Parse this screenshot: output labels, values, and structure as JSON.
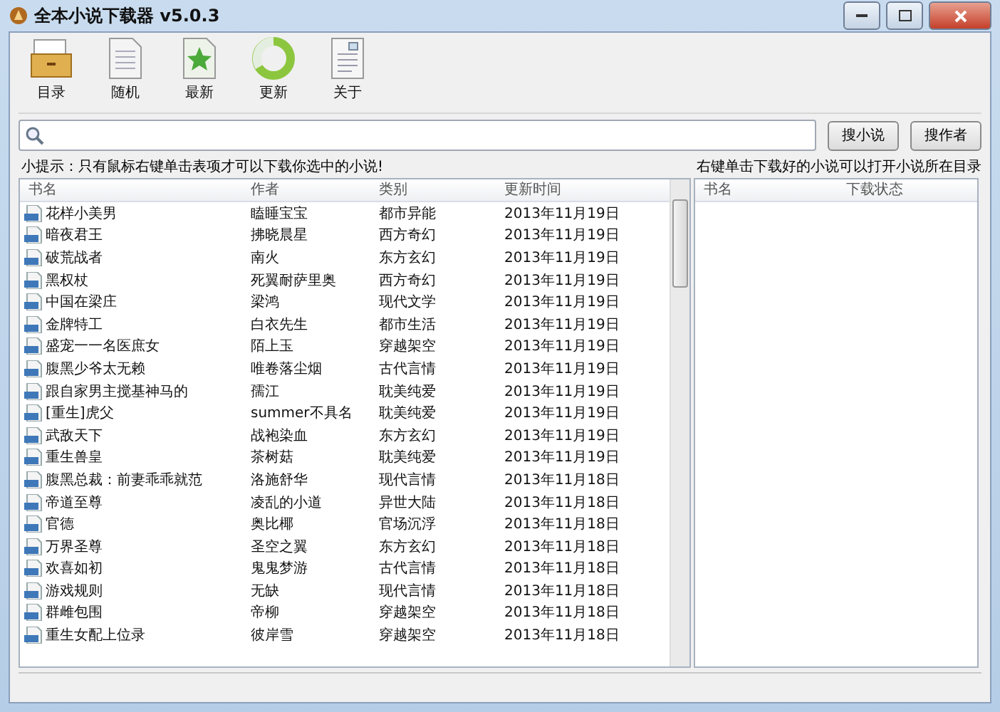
{
  "window": {
    "title": "全本小说下载器 v5.0.3"
  },
  "toolbar": [
    {
      "label": "目录",
      "kind": "folder"
    },
    {
      "label": "随机",
      "kind": "document"
    },
    {
      "label": "最新",
      "kind": "star"
    },
    {
      "label": "更新",
      "kind": "ring"
    },
    {
      "label": "关于",
      "kind": "about"
    }
  ],
  "search": {
    "buttons": [
      "搜小说",
      "搜作者"
    ]
  },
  "left_panel": {
    "hint": "小提示：只有鼠标右键单击表项才可以下载你选中的小说!",
    "columns": [
      "书名",
      "作者",
      "类别",
      "更新时间"
    ],
    "rows": [
      [
        "花样小美男",
        "瞌睡宝宝",
        "都市异能",
        "2013年11月19日"
      ],
      [
        "暗夜君王",
        "拂晓晨星",
        "西方奇幻",
        "2013年11月19日"
      ],
      [
        "破荒战者",
        "南火",
        "东方玄幻",
        "2013年11月19日"
      ],
      [
        "黑权杖",
        "死翼耐萨里奥",
        "西方奇幻",
        "2013年11月19日"
      ],
      [
        "中国在梁庄",
        "梁鸿",
        "现代文学",
        "2013年11月19日"
      ],
      [
        "金牌特工",
        "白衣先生",
        "都市生活",
        "2013年11月19日"
      ],
      [
        "盛宠一一名医庶女",
        "陌上玉",
        "穿越架空",
        "2013年11月19日"
      ],
      [
        "腹黑少爷太无赖",
        "唯卷落尘烟",
        "古代言情",
        "2013年11月19日"
      ],
      [
        "跟自家男主搅基神马的",
        "孺江",
        "耽美纯爱",
        "2013年11月19日"
      ],
      [
        "[重生]虎父",
        "summer不具名",
        "耽美纯爱",
        "2013年11月19日"
      ],
      [
        "武敌天下",
        "战袍染血",
        "东方玄幻",
        "2013年11月19日"
      ],
      [
        "重生兽皇",
        "茶树菇",
        "耽美纯爱",
        "2013年11月19日"
      ],
      [
        "腹黑总裁：前妻乖乖就范",
        "洛施舒华",
        "现代言情",
        "2013年11月18日"
      ],
      [
        "帝道至尊",
        "凌乱的小道",
        "异世大陆",
        "2013年11月18日"
      ],
      [
        "官德",
        "奥比椰",
        "官场沉浮",
        "2013年11月18日"
      ],
      [
        "万界圣尊",
        "圣空之翼",
        "东方玄幻",
        "2013年11月18日"
      ],
      [
        "欢喜如初",
        "鬼鬼梦游",
        "古代言情",
        "2013年11月18日"
      ],
      [
        "游戏规则",
        "无缺",
        "现代言情",
        "2013年11月18日"
      ],
      [
        "群雌包围",
        "帝柳",
        "穿越架空",
        "2013年11月18日"
      ],
      [
        "重生女配上位录",
        "彼岸雪",
        "穿越架空",
        "2013年11月18日"
      ]
    ]
  },
  "right_panel": {
    "hint": "右键单击下载好的小说可以打开小说所在目录",
    "columns": [
      "书名",
      "下载状态"
    ]
  }
}
